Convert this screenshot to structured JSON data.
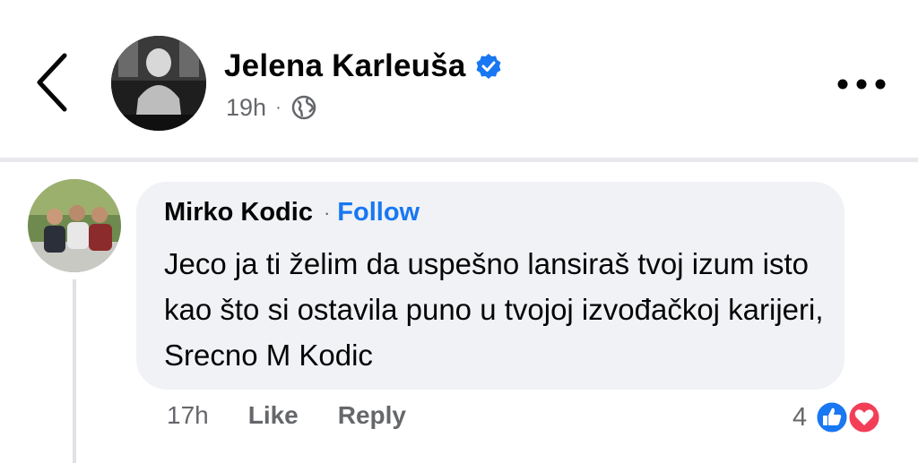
{
  "post": {
    "author": "Jelena Karleuša",
    "time": "19h",
    "separator": "·",
    "icons": {
      "back": "chevron-left-icon",
      "verified": "verified-badge-icon",
      "audience": "globe-icon",
      "more": "more-horizontal-icon"
    }
  },
  "comment": {
    "author": "Mirko Kodic",
    "separator": "·",
    "follow_label": "Follow",
    "text": "Jeco ja ti želim da uspešno lansiraš tvoj izum isto kao što si ostavila puno u tvojoj izvođačkoj karijeri, Srecno M Kodic",
    "time": "17h",
    "like_label": "Like",
    "reply_label": "Reply",
    "reaction_count": "4",
    "reactions": [
      "like-reaction-icon",
      "love-reaction-icon"
    ]
  },
  "colors": {
    "accent": "#1877f2",
    "secondary_text": "#65676b",
    "bubble": "#f0f2f5",
    "love": "#f33e58"
  }
}
